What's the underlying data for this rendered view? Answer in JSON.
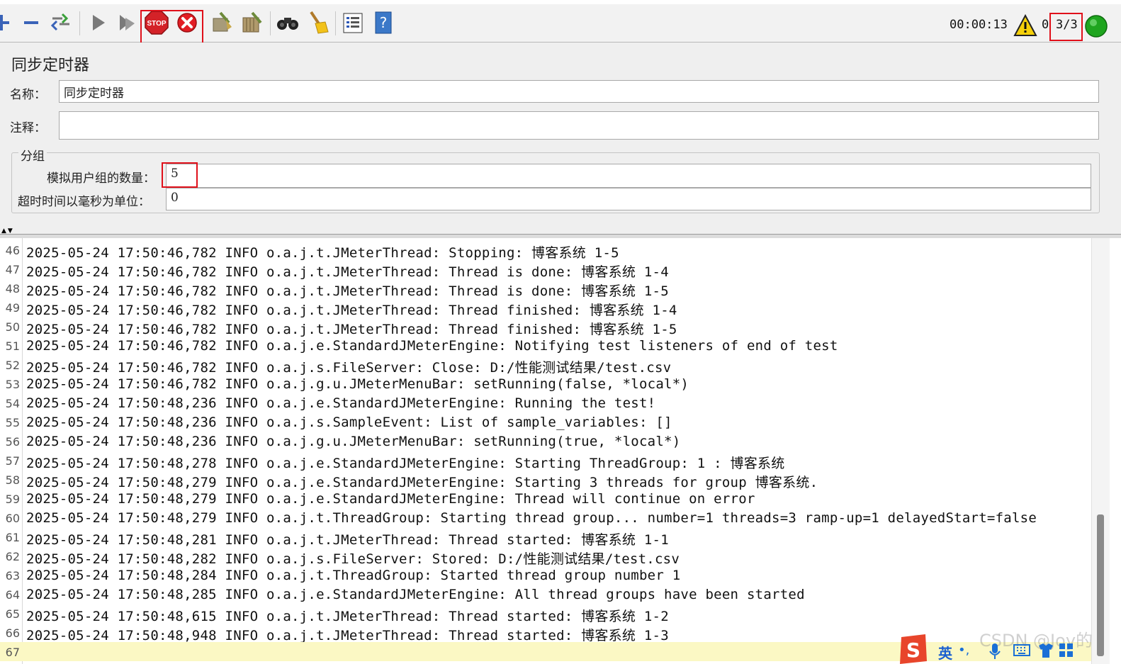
{
  "toolbar": {
    "buttons": [
      {
        "name": "expand-icon",
        "interactable": true
      },
      {
        "name": "collapse-icon",
        "interactable": true
      },
      {
        "name": "toggle-icon",
        "interactable": true
      },
      {
        "name": "start-icon",
        "interactable": true
      },
      {
        "name": "start-no-pause-icon",
        "interactable": true
      },
      {
        "name": "stop-icon",
        "interactable": true,
        "label": "STOP"
      },
      {
        "name": "shutdown-icon",
        "interactable": true
      },
      {
        "name": "clear-icon",
        "interactable": true
      },
      {
        "name": "clear-all-icon",
        "interactable": true
      },
      {
        "name": "search-icon",
        "interactable": true
      },
      {
        "name": "reset-search-icon",
        "interactable": true
      },
      {
        "name": "function-helper-icon",
        "interactable": true
      },
      {
        "name": "help-icon",
        "interactable": true
      }
    ],
    "elapsed_time": "00:00:13",
    "warning_icon": "warning-icon",
    "error_count": "0",
    "active_threads": "3/3",
    "status_icon": "running-status-icon",
    "status_color": "#1fa51f",
    "highlight_color": "#e0101a"
  },
  "panel": {
    "title": "同步定时器",
    "name_label": "名称：",
    "name_value": "同步定时器",
    "comment_label": "注释：",
    "comment_value": "",
    "group_legend": "分组",
    "users_label": "模拟用户组的数量：",
    "users_value": "5",
    "timeout_label": "超时时间以毫秒为单位：",
    "timeout_value": "0"
  },
  "log": {
    "lines": [
      {
        "n": "46",
        "text": "2025-05-24 17:50:46,782 INFO o.a.j.t.JMeterThread: Stopping: 博客系统 1-5"
      },
      {
        "n": "47",
        "text": "2025-05-24 17:50:46,782 INFO o.a.j.t.JMeterThread: Thread is done: 博客系统 1-4"
      },
      {
        "n": "48",
        "text": "2025-05-24 17:50:46,782 INFO o.a.j.t.JMeterThread: Thread is done: 博客系统 1-5"
      },
      {
        "n": "49",
        "text": "2025-05-24 17:50:46,782 INFO o.a.j.t.JMeterThread: Thread finished: 博客系统 1-4"
      },
      {
        "n": "50",
        "text": "2025-05-24 17:50:46,782 INFO o.a.j.t.JMeterThread: Thread finished: 博客系统 1-5"
      },
      {
        "n": "51",
        "text": "2025-05-24 17:50:46,782 INFO o.a.j.e.StandardJMeterEngine: Notifying test listeners of end of test"
      },
      {
        "n": "52",
        "text": "2025-05-24 17:50:46,782 INFO o.a.j.s.FileServer: Close: D:/性能测试结果/test.csv"
      },
      {
        "n": "53",
        "text": "2025-05-24 17:50:46,782 INFO o.a.j.g.u.JMeterMenuBar: setRunning(false, *local*)"
      },
      {
        "n": "54",
        "text": "2025-05-24 17:50:48,236 INFO o.a.j.e.StandardJMeterEngine: Running the test!"
      },
      {
        "n": "55",
        "text": "2025-05-24 17:50:48,236 INFO o.a.j.s.SampleEvent: List of sample_variables: []"
      },
      {
        "n": "56",
        "text": "2025-05-24 17:50:48,236 INFO o.a.j.g.u.JMeterMenuBar: setRunning(true, *local*)"
      },
      {
        "n": "57",
        "text": "2025-05-24 17:50:48,278 INFO o.a.j.e.StandardJMeterEngine: Starting ThreadGroup: 1 : 博客系统"
      },
      {
        "n": "58",
        "text": "2025-05-24 17:50:48,279 INFO o.a.j.e.StandardJMeterEngine: Starting 3 threads for group 博客系统."
      },
      {
        "n": "59",
        "text": "2025-05-24 17:50:48,279 INFO o.a.j.e.StandardJMeterEngine: Thread will continue on error"
      },
      {
        "n": "60",
        "text": "2025-05-24 17:50:48,279 INFO o.a.j.t.ThreadGroup: Starting thread group... number=1 threads=3 ramp-up=1 delayedStart=false"
      },
      {
        "n": "61",
        "text": "2025-05-24 17:50:48,281 INFO o.a.j.t.JMeterThread: Thread started: 博客系统 1-1"
      },
      {
        "n": "62",
        "text": "2025-05-24 17:50:48,282 INFO o.a.j.s.FileServer: Stored: D:/性能测试结果/test.csv"
      },
      {
        "n": "63",
        "text": "2025-05-24 17:50:48,284 INFO o.a.j.t.ThreadGroup: Started thread group number 1"
      },
      {
        "n": "64",
        "text": "2025-05-24 17:50:48,285 INFO o.a.j.e.StandardJMeterEngine: All thread groups have been started"
      },
      {
        "n": "65",
        "text": "2025-05-24 17:50:48,615 INFO o.a.j.t.JMeterThread: Thread started: 博客系统 1-2"
      },
      {
        "n": "66",
        "text": "2025-05-24 17:50:48,948 INFO o.a.j.t.JMeterThread: Thread started: 博客系统 1-3"
      },
      {
        "n": "67",
        "text": ""
      }
    ]
  },
  "overlay": {
    "watermark": "CSDN @Joy的",
    "ime_lang": "英",
    "ime_punct": "•,"
  }
}
